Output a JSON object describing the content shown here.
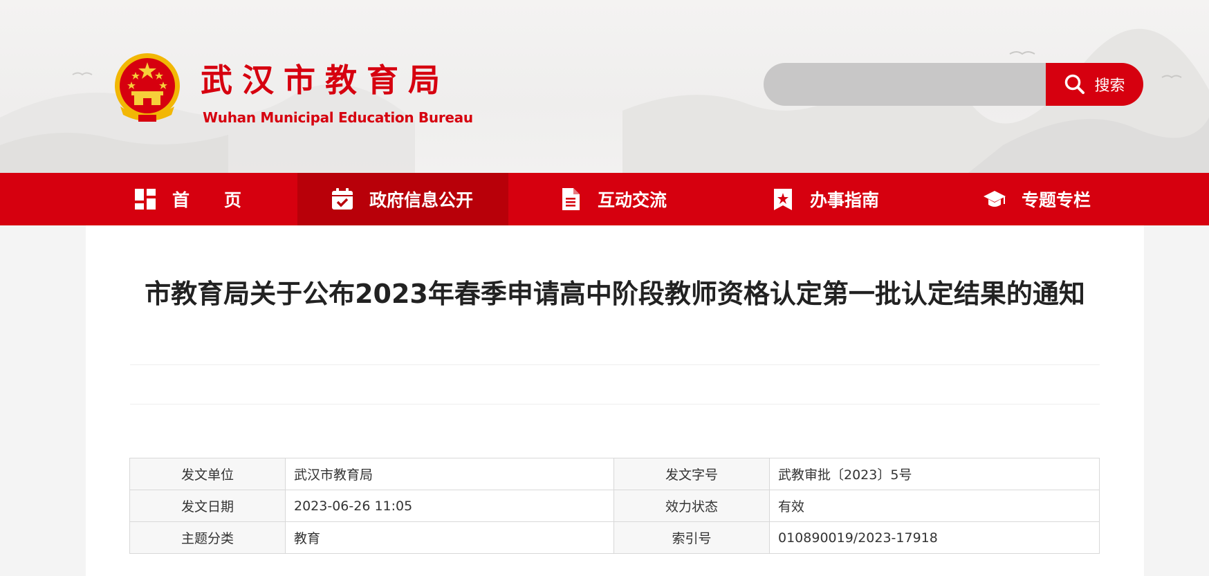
{
  "header": {
    "site_name": "武汉市教育局",
    "site_name_en": "Wuhan Municipal Education Bureau",
    "search": {
      "placeholder": "",
      "value": "",
      "button_label": "搜索"
    }
  },
  "nav": {
    "items": [
      {
        "label": "首　　页",
        "icon": "home-grid-icon",
        "active": false
      },
      {
        "label": "政府信息公开",
        "icon": "calendar-check-icon",
        "active": true
      },
      {
        "label": "互动交流",
        "icon": "document-icon",
        "active": false
      },
      {
        "label": "办事指南",
        "icon": "bookmark-star-icon",
        "active": false
      },
      {
        "label": "专题专栏",
        "icon": "graduation-cap-icon",
        "active": false
      }
    ]
  },
  "article": {
    "title": "市教育局关于公布2023年春季申请高中阶段教师资格认定第一批认定结果的通知"
  },
  "meta_table": {
    "rows": [
      {
        "k1": "发文单位",
        "v1": "武汉市教育局",
        "k2": "发文字号",
        "v2": "武教审批〔2023〕5号"
      },
      {
        "k1": "发文日期",
        "v1": "2023-06-26 11:05",
        "k2": "效力状态",
        "v2": "有效"
      },
      {
        "k1": "主题分类",
        "v1": "教育",
        "k2": "索引号",
        "v2": "010890019/2023-17918"
      }
    ]
  },
  "colors": {
    "brand_red": "#d6000f",
    "active_nav": "#b80009",
    "search_bg": "#c8c7c7"
  }
}
